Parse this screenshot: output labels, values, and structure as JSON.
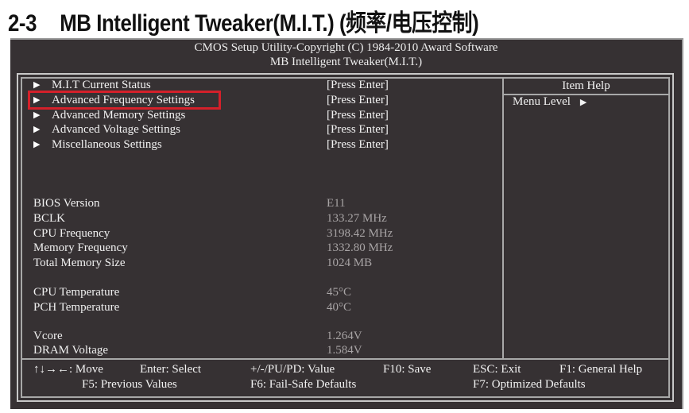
{
  "doc": {
    "section_number": "2-3",
    "section_title": "MB Intelligent Tweaker(M.I.T.) (频率/电压控制)"
  },
  "bios": {
    "header_line1": "CMOS Setup Utility-Copyright (C) 1984-2010 Award Software",
    "header_line2": "MB Intelligent Tweaker(M.I.T.)",
    "highlight_color": "#d4202a",
    "menu_items": [
      {
        "label": "M.I.T Current Status",
        "value": "[Press Enter]",
        "icon": "triangle-right-icon"
      },
      {
        "label": "Advanced Frequency Settings",
        "value": "[Press Enter]",
        "icon": "triangle-right-icon",
        "selected": true
      },
      {
        "label": "Advanced Memory Settings",
        "value": "[Press Enter]",
        "icon": "triangle-right-icon"
      },
      {
        "label": "Advanced Voltage Settings",
        "value": "[Press Enter]",
        "icon": "triangle-right-icon"
      },
      {
        "label": "Miscellaneous Settings",
        "value": "[Press Enter]",
        "icon": "triangle-right-icon"
      }
    ],
    "info": [
      {
        "label": "BIOS Version",
        "value": "E11"
      },
      {
        "label": "BCLK",
        "value": "133.27 MHz"
      },
      {
        "label": "CPU Frequency",
        "value": "3198.42 MHz"
      },
      {
        "label": "Memory Frequency",
        "value": "1332.80 MHz"
      },
      {
        "label": "Total Memory Size",
        "value": "1024 MB"
      },
      {
        "label": "CPU Temperature",
        "value": "45°C"
      },
      {
        "label": "PCH Temperature",
        "value": "40°C"
      },
      {
        "label": "Vcore",
        "value": "1.264V"
      },
      {
        "label": "DRAM Voltage",
        "value": "1.584V"
      }
    ],
    "help": {
      "title": "Item Help",
      "menu_level": "Menu Level",
      "menu_level_icon": "triangle-right-icon"
    },
    "footer": {
      "move": "↑↓→←: Move",
      "select": "Enter: Select",
      "value": "+/-/PU/PD: Value",
      "save": "F10: Save",
      "exit": "ESC: Exit",
      "general_help": "F1: General Help",
      "previous": "F5: Previous Values",
      "failsafe": "F6: Fail-Safe Defaults",
      "optimized": "F7: Optimized Defaults"
    }
  }
}
